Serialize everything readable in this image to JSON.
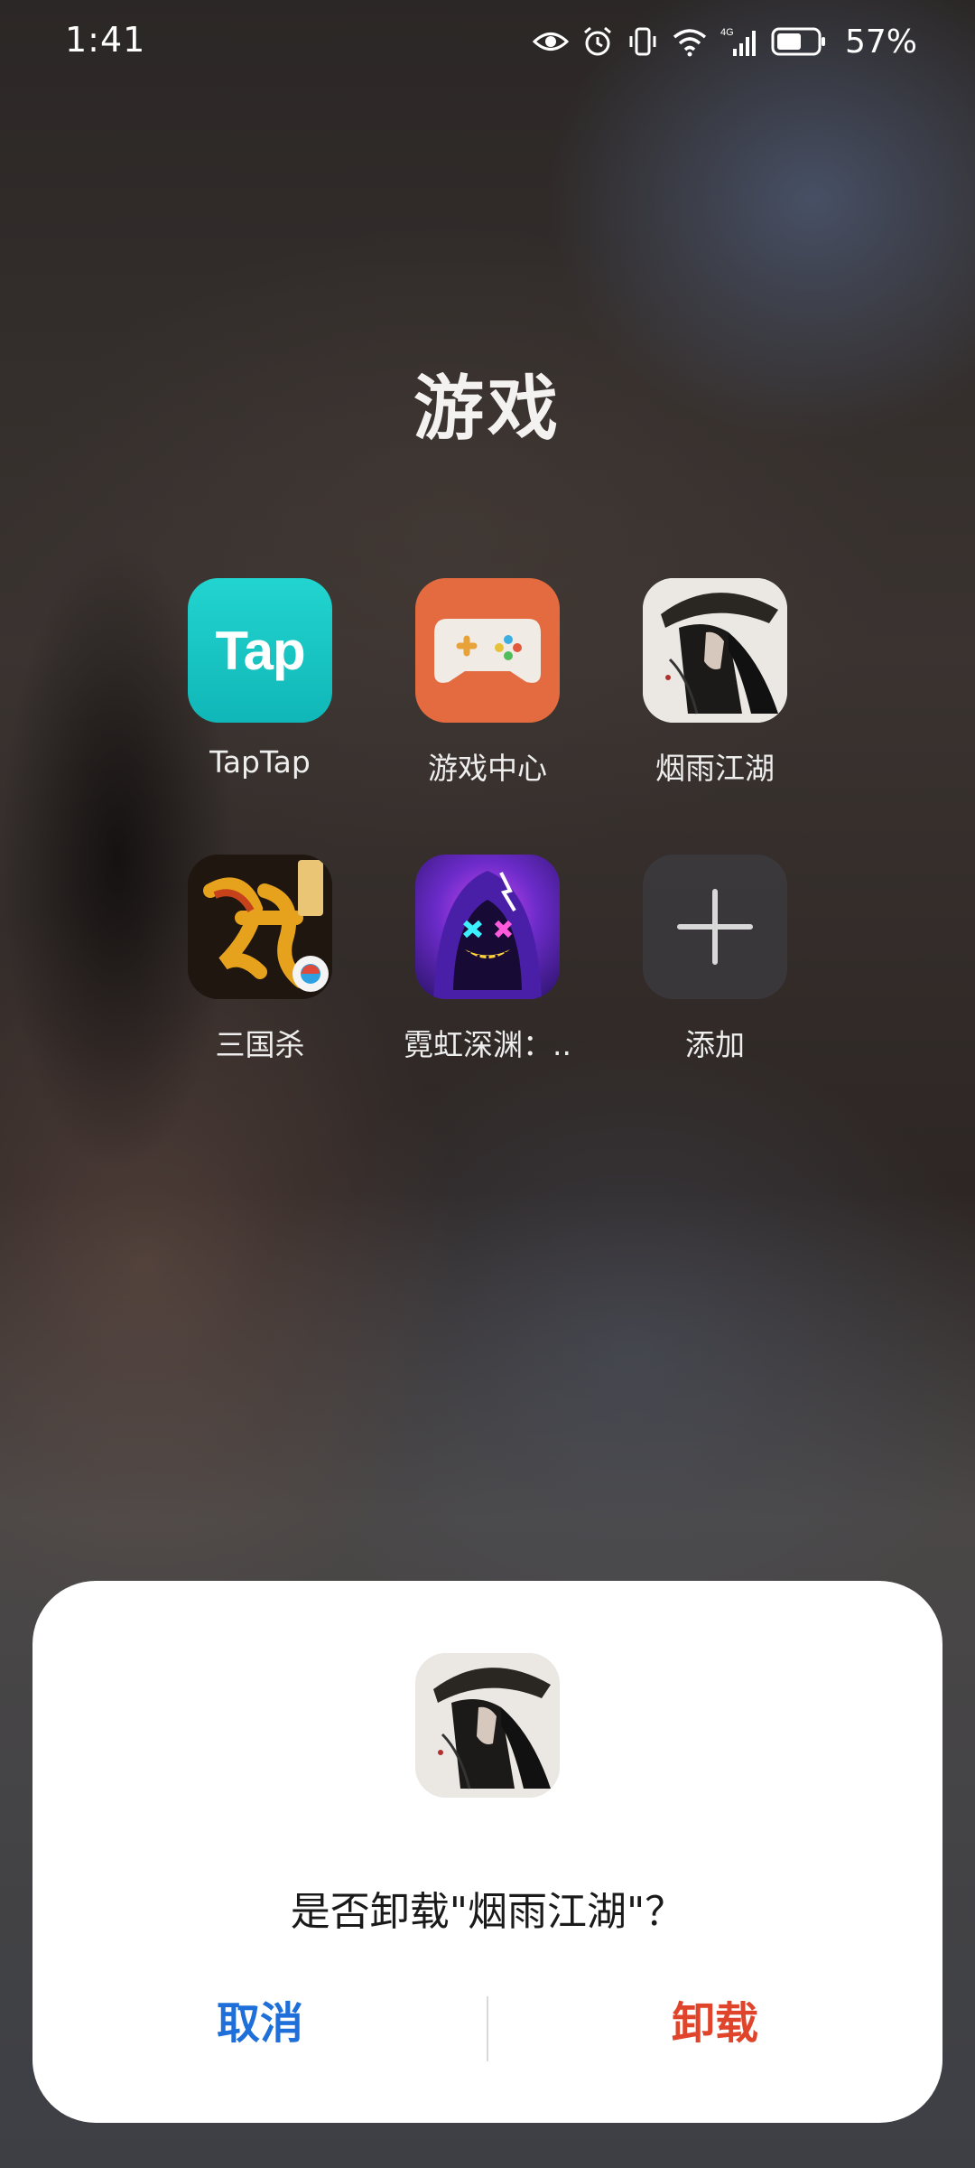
{
  "status_bar": {
    "time": "1:41",
    "network": "4G",
    "battery": "57%",
    "icons": [
      "eye-icon",
      "alarm-icon",
      "vibrate-icon",
      "wifi-icon",
      "signal-icon",
      "battery-icon"
    ]
  },
  "folder": {
    "title": "游戏",
    "apps": [
      {
        "label": "TapTap",
        "icon": "taptap-icon",
        "icon_text": "Tap"
      },
      {
        "label": "游戏中心",
        "icon": "game-center-icon"
      },
      {
        "label": "烟雨江湖",
        "icon": "yanyu-jianghu-icon"
      },
      {
        "label": "三国杀",
        "icon": "sanguosha-icon"
      },
      {
        "label": "霓虹深渊：..",
        "icon": "neon-abyss-icon"
      },
      {
        "label": "添加",
        "icon": "add-icon"
      }
    ]
  },
  "dialog": {
    "message": "是否卸载\"烟雨江湖\"？",
    "cancel_label": "取消",
    "uninstall_label": "卸载",
    "colors": {
      "cancel": "#1e6fd9",
      "uninstall": "#e0442a"
    }
  }
}
